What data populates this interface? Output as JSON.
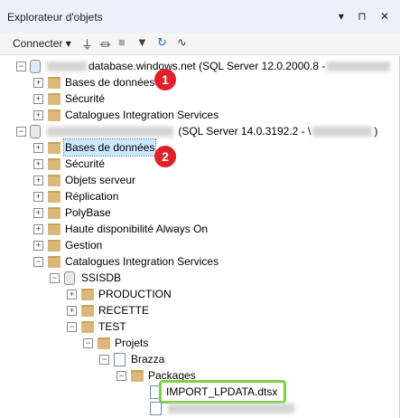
{
  "panel": {
    "title": "Explorateur d'objets",
    "window_icons": "▾ ⊓ ✕"
  },
  "toolbar": {
    "connect_label": "Connecter ▾",
    "tools": [
      "plug-icon",
      "disconnect-icon",
      "stop-icon",
      "filter-icon",
      "refresh-icon",
      "activity-icon"
    ]
  },
  "tree": {
    "server1_host": "database.windows.net",
    "server1_version": "(SQL Server 12.0.2000.8 -",
    "server2_version": "(SQL Server 14.0.3192.2 - \\",
    "server2_close": ")",
    "bases": "Bases de données",
    "securite": "Sécurité",
    "catalogues": "Catalogues Integration Services",
    "objets_serveur": "Objets serveur",
    "replication": "Réplication",
    "polybase": "PolyBase",
    "haute_dispo": "Haute disponibilité Always On",
    "gestion": "Gestion",
    "ssisdb": "SSISDB",
    "production": "PRODUCTION",
    "recette": "RECETTE",
    "test": "TEST",
    "projets": "Projets",
    "brazza": "Brazza",
    "packages": "Packages",
    "import_pkg": "IMPORT_LPDATA.dtsx"
  },
  "badges": {
    "one": "1",
    "two": "2"
  },
  "colors": {
    "badge": "#e3202a",
    "highlight": "#7dd143",
    "selection": "#cce8ff"
  }
}
